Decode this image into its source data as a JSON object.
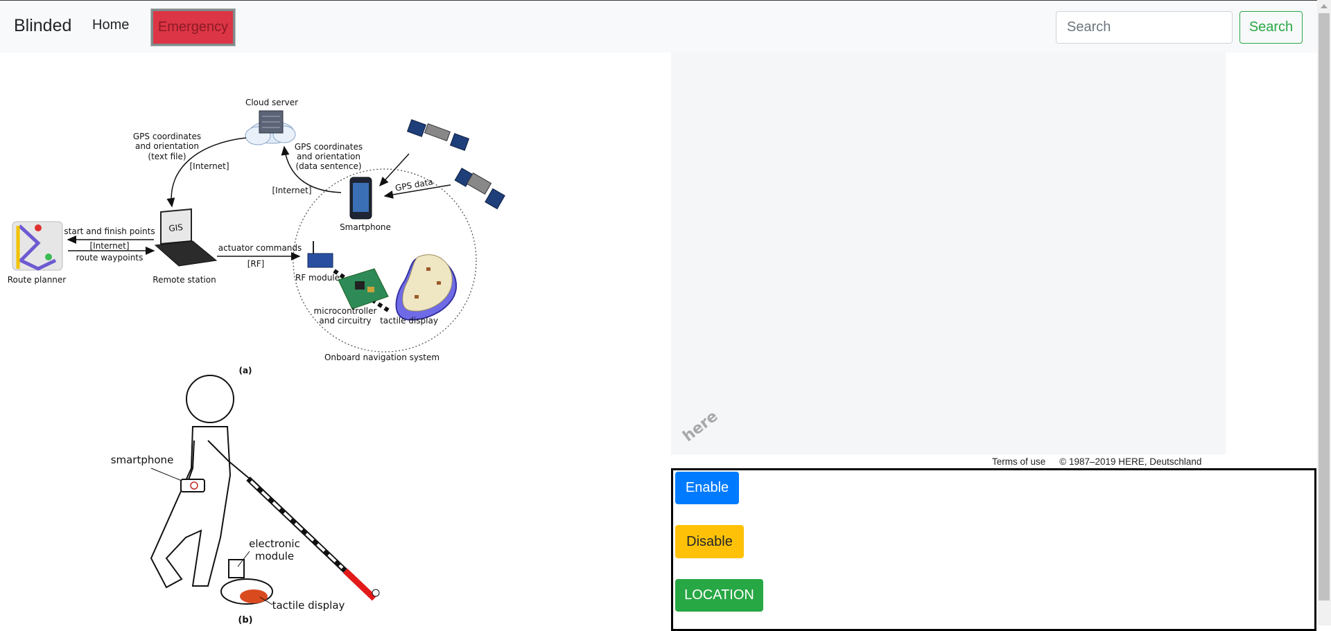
{
  "navbar": {
    "brand": "Blinded",
    "home_label": "Home",
    "emergency_label": "Emergency",
    "search_placeholder": "Search",
    "search_button": "Search"
  },
  "figure": {
    "labels": {
      "cloud_server": "Cloud server",
      "gps_text_file_1": "GPS coordinates",
      "gps_text_file_2": "and orientation",
      "gps_text_file_3": "(text file)",
      "internet_1": "[Internet]",
      "gps_sentence_1": "GPS coordinates",
      "gps_sentence_2": "and orientation",
      "gps_sentence_3": "(data sentence)",
      "internet_2": "[Internet]",
      "gps_data": "GPS data",
      "smartphone": "Smartphone",
      "start_finish": "start and finish points",
      "internet_3": "[Internet]",
      "route_waypoints": "route waypoints",
      "gis": "GIS",
      "route_planner": "Route planner",
      "remote_station": "Remote station",
      "actuator_commands": "actuator commands",
      "rf": "[RF]",
      "rf_module": "RF module",
      "microcontroller_1": "microcontroller",
      "microcontroller_2": "and circuitry",
      "tactile_display_a": "tactile display",
      "onboard": "Onboard navigation system",
      "caption_a": "(a)",
      "smartphone_b": "smartphone",
      "electronic_1": "electronic",
      "electronic_2": "module",
      "tactile_display_b": "tactile display",
      "caption_b": "(b)"
    }
  },
  "map": {
    "logo": "here",
    "terms": "Terms of use",
    "copyright": "© 1987–2019 HERE, Deutschland"
  },
  "controls": {
    "enable": "Enable",
    "disable": "Disable",
    "location": "LOCATION"
  },
  "colors": {
    "primary": "#007bff",
    "warning": "#ffc107",
    "success": "#28a745",
    "danger": "#dc3545",
    "navbar_bg": "#f8f9fa",
    "map_bg": "#f4f6f8"
  }
}
